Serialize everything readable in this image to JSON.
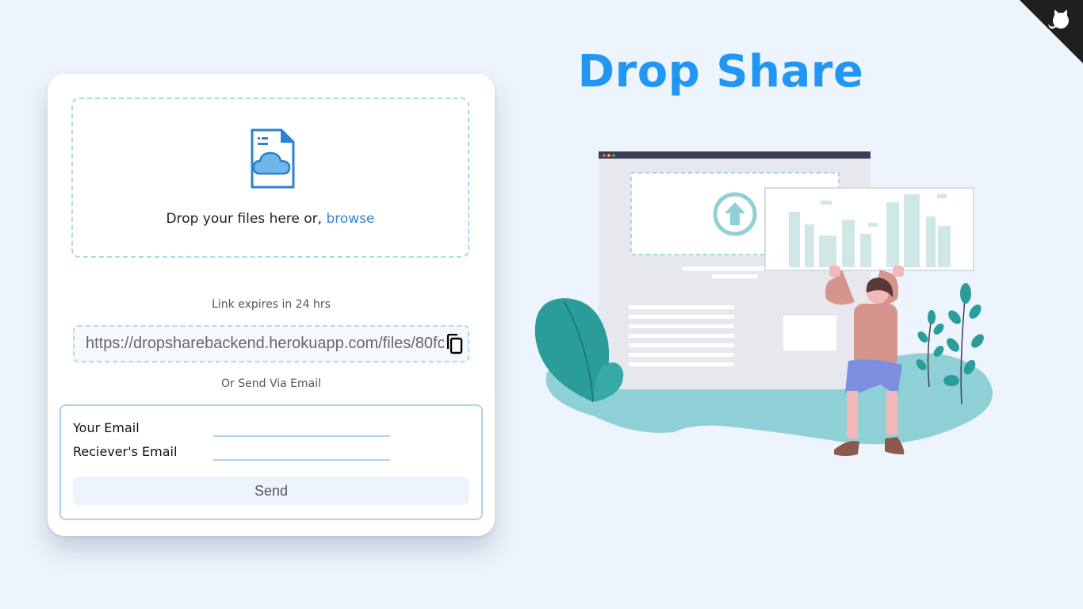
{
  "app": {
    "title": "Drop Share"
  },
  "upload": {
    "drop_text": "Drop your files here or, ",
    "browse_label": "browse"
  },
  "share": {
    "expiry_text": "Link expires in 24 hrs",
    "link_value": "https://dropsharebackend.herokuapp.com/files/80fc",
    "or_text": "Or Send Via Email"
  },
  "email_form": {
    "sender_label": "Your Email",
    "receiver_label": "Reciever's Email",
    "sender_value": "",
    "receiver_value": "",
    "send_label": "Send"
  },
  "icons": {
    "corner": "github-octocat-icon",
    "file": "file-cloud-icon",
    "copy": "copy-icon",
    "upload": "upload-arrow-icon"
  },
  "colors": {
    "background": "#eef4fd",
    "accent": "#2196f3",
    "link": "#2f86d6",
    "dashed_border": "#a9dbef",
    "illustration_teal": "#2a9d9b",
    "illustration_blob": "#8fcfd6"
  }
}
